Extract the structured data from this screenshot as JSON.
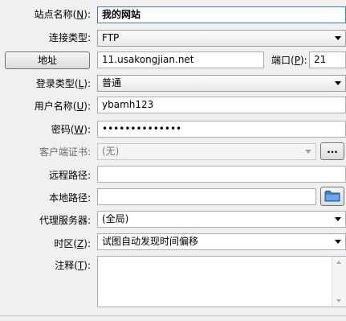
{
  "site_name": {
    "label_pre": "站点名称(",
    "label_key": "N",
    "label_post": "):",
    "value": "我的网站"
  },
  "conn_type": {
    "label": "连接类型:",
    "value": "FTP"
  },
  "address": {
    "button": "地址",
    "value": "11.usakongjian.net",
    "port_pre": "端口(",
    "port_key": "P",
    "port_post": "):",
    "port": "21"
  },
  "login_type": {
    "label_pre": "登录类型(",
    "label_key": "L",
    "label_post": "):",
    "value": "普通"
  },
  "username": {
    "label_pre": "用户名称(",
    "label_key": "U",
    "label_post": "):",
    "value": "ybamh123"
  },
  "password": {
    "label_pre": "密码(",
    "label_key": "W",
    "label_post": "):",
    "value": "••••••••••••••"
  },
  "client_cert": {
    "label": "客户端证书:",
    "value": "(无)",
    "browse": "..."
  },
  "remote_path": {
    "label": "远程路径:",
    "value": ""
  },
  "local_path": {
    "label": "本地路径:",
    "value": ""
  },
  "proxy": {
    "label": "代理服务器:",
    "value": "(全局)"
  },
  "timezone": {
    "label_pre": "时区(",
    "label_key": "Z",
    "label_post": "):",
    "value": "试图自动发现时间偏移"
  },
  "notes": {
    "label_pre": "注释(",
    "label_key": "T",
    "label_post": "):",
    "value": ""
  }
}
